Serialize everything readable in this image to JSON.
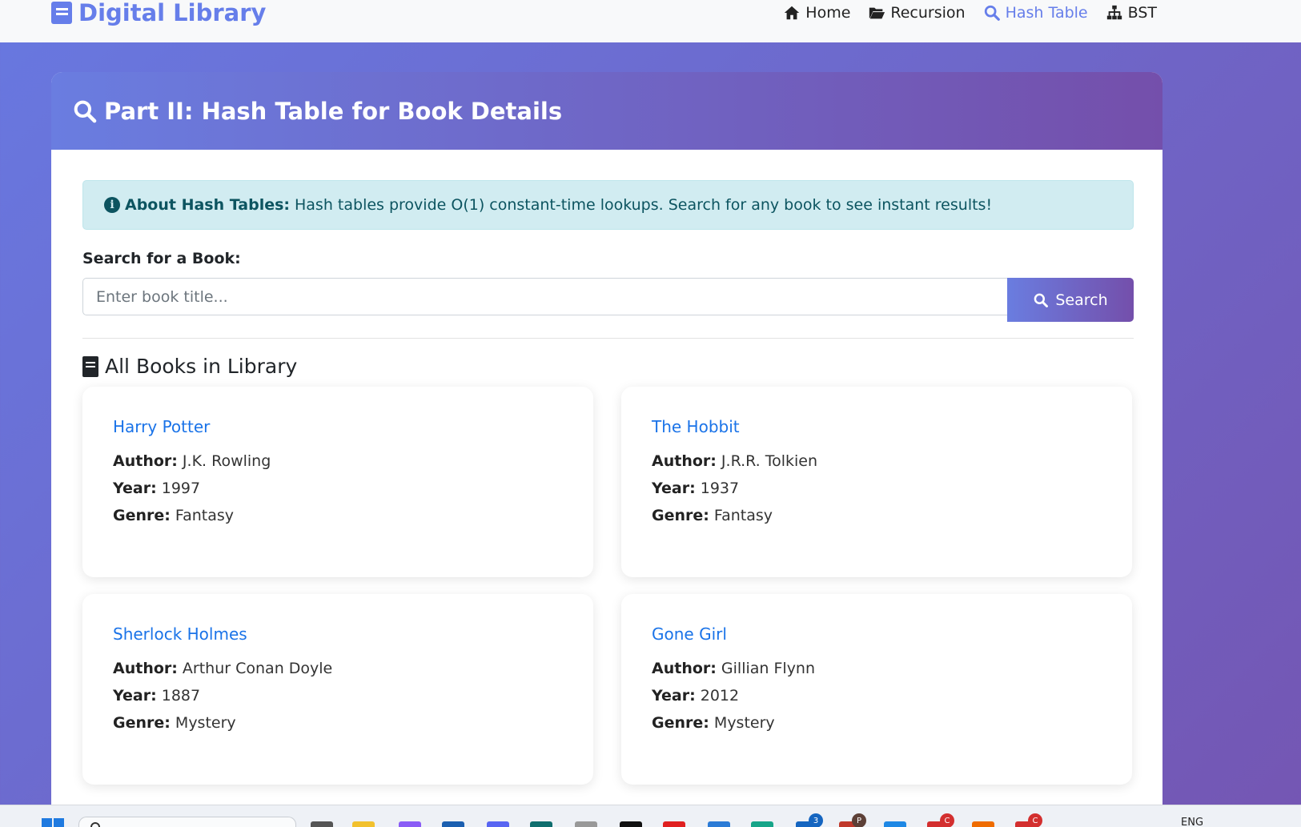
{
  "navbar": {
    "brand": "Digital Library",
    "links": [
      {
        "label": "Home",
        "icon": "home-icon"
      },
      {
        "label": "Recursion",
        "icon": "folder-open-icon"
      },
      {
        "label": "Hash Table",
        "icon": "search-icon",
        "active": true
      },
      {
        "label": "BST",
        "icon": "sitemap-icon"
      }
    ]
  },
  "main": {
    "header_title": "Part II: Hash Table for Book Details",
    "alert": {
      "title": "About Hash Tables:",
      "text": "Hash tables provide O(1) constant-time lookups. Search for any book to see instant results!"
    },
    "search": {
      "label": "Search for a Book:",
      "placeholder": "Enter book title...",
      "button_label": "Search"
    },
    "section_title": "All Books in Library",
    "labels": {
      "author": "Author:",
      "year": "Year:",
      "genre": "Genre:"
    },
    "books": [
      {
        "title": "Harry Potter",
        "author": "J.K. Rowling",
        "year": "1997",
        "genre": "Fantasy"
      },
      {
        "title": "The Hobbit",
        "author": "J.R.R. Tolkien",
        "year": "1937",
        "genre": "Fantasy"
      },
      {
        "title": "Sherlock Holmes",
        "author": "Arthur Conan Doyle",
        "year": "1887",
        "genre": "Mystery"
      },
      {
        "title": "Gone Girl",
        "author": "Gillian Flynn",
        "year": "2012",
        "genre": "Mystery"
      }
    ]
  },
  "taskbar": {
    "language": "ENG",
    "badges": [
      "3",
      "P",
      "C",
      "C"
    ]
  },
  "colors": {
    "accent": "#667eea",
    "accent_dark": "#764ba2",
    "link": "#1a73e8",
    "alert_bg": "#d1ecf1",
    "alert_text": "#0c5460"
  }
}
